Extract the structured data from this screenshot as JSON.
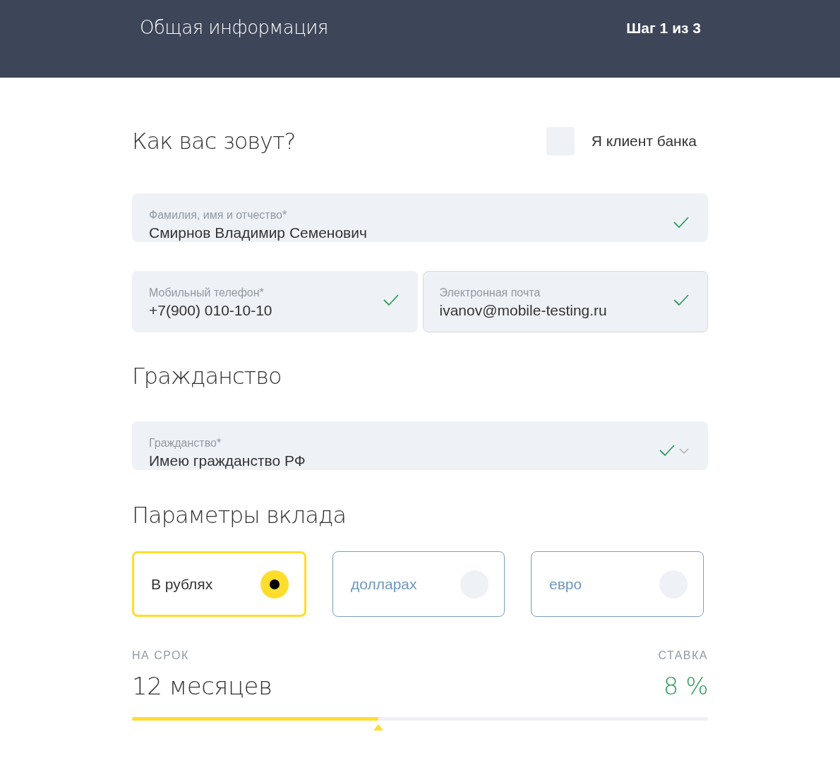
{
  "header": {
    "title": "Общая информация",
    "step": "Шаг 1 из 3"
  },
  "name_section": {
    "heading": "Как вас зовут?",
    "client_checkbox": {
      "label": "Я клиент банка",
      "checked": false
    }
  },
  "contact_fields": [
    {
      "label": "Фамилия, имя и отчество",
      "required_mark": "*",
      "value": "Смирнов Владимир Семенович",
      "valid": true,
      "outlined": false
    },
    {
      "label": "Мобильный телефон",
      "required_mark": "*",
      "value": "+7(900) 010-10-10",
      "valid": true,
      "outlined": false
    },
    {
      "label": "Электронная почта",
      "value": "ivanov@mobile-testing.ru",
      "valid": true,
      "outlined": true
    }
  ],
  "citizenship_section": {
    "heading": "Гражданство",
    "field": {
      "label": "Гражданство",
      "required_mark": "*",
      "value": "Имею гражданство РФ",
      "valid": true,
      "outlined": false,
      "kind": "select"
    }
  },
  "deposit_section": {
    "heading": "Параметры вклада",
    "currencies": [
      {
        "label": "В рублях",
        "selected": true
      },
      {
        "label": "долларах",
        "selected": false
      },
      {
        "label": "евро",
        "selected": false
      }
    ],
    "term_label": "НА СРОК",
    "rate_label": "СТАВКА",
    "term_value": "12 месяцев",
    "rate_value": "8 %",
    "term_slider": {
      "level": 0.428
    }
  }
}
